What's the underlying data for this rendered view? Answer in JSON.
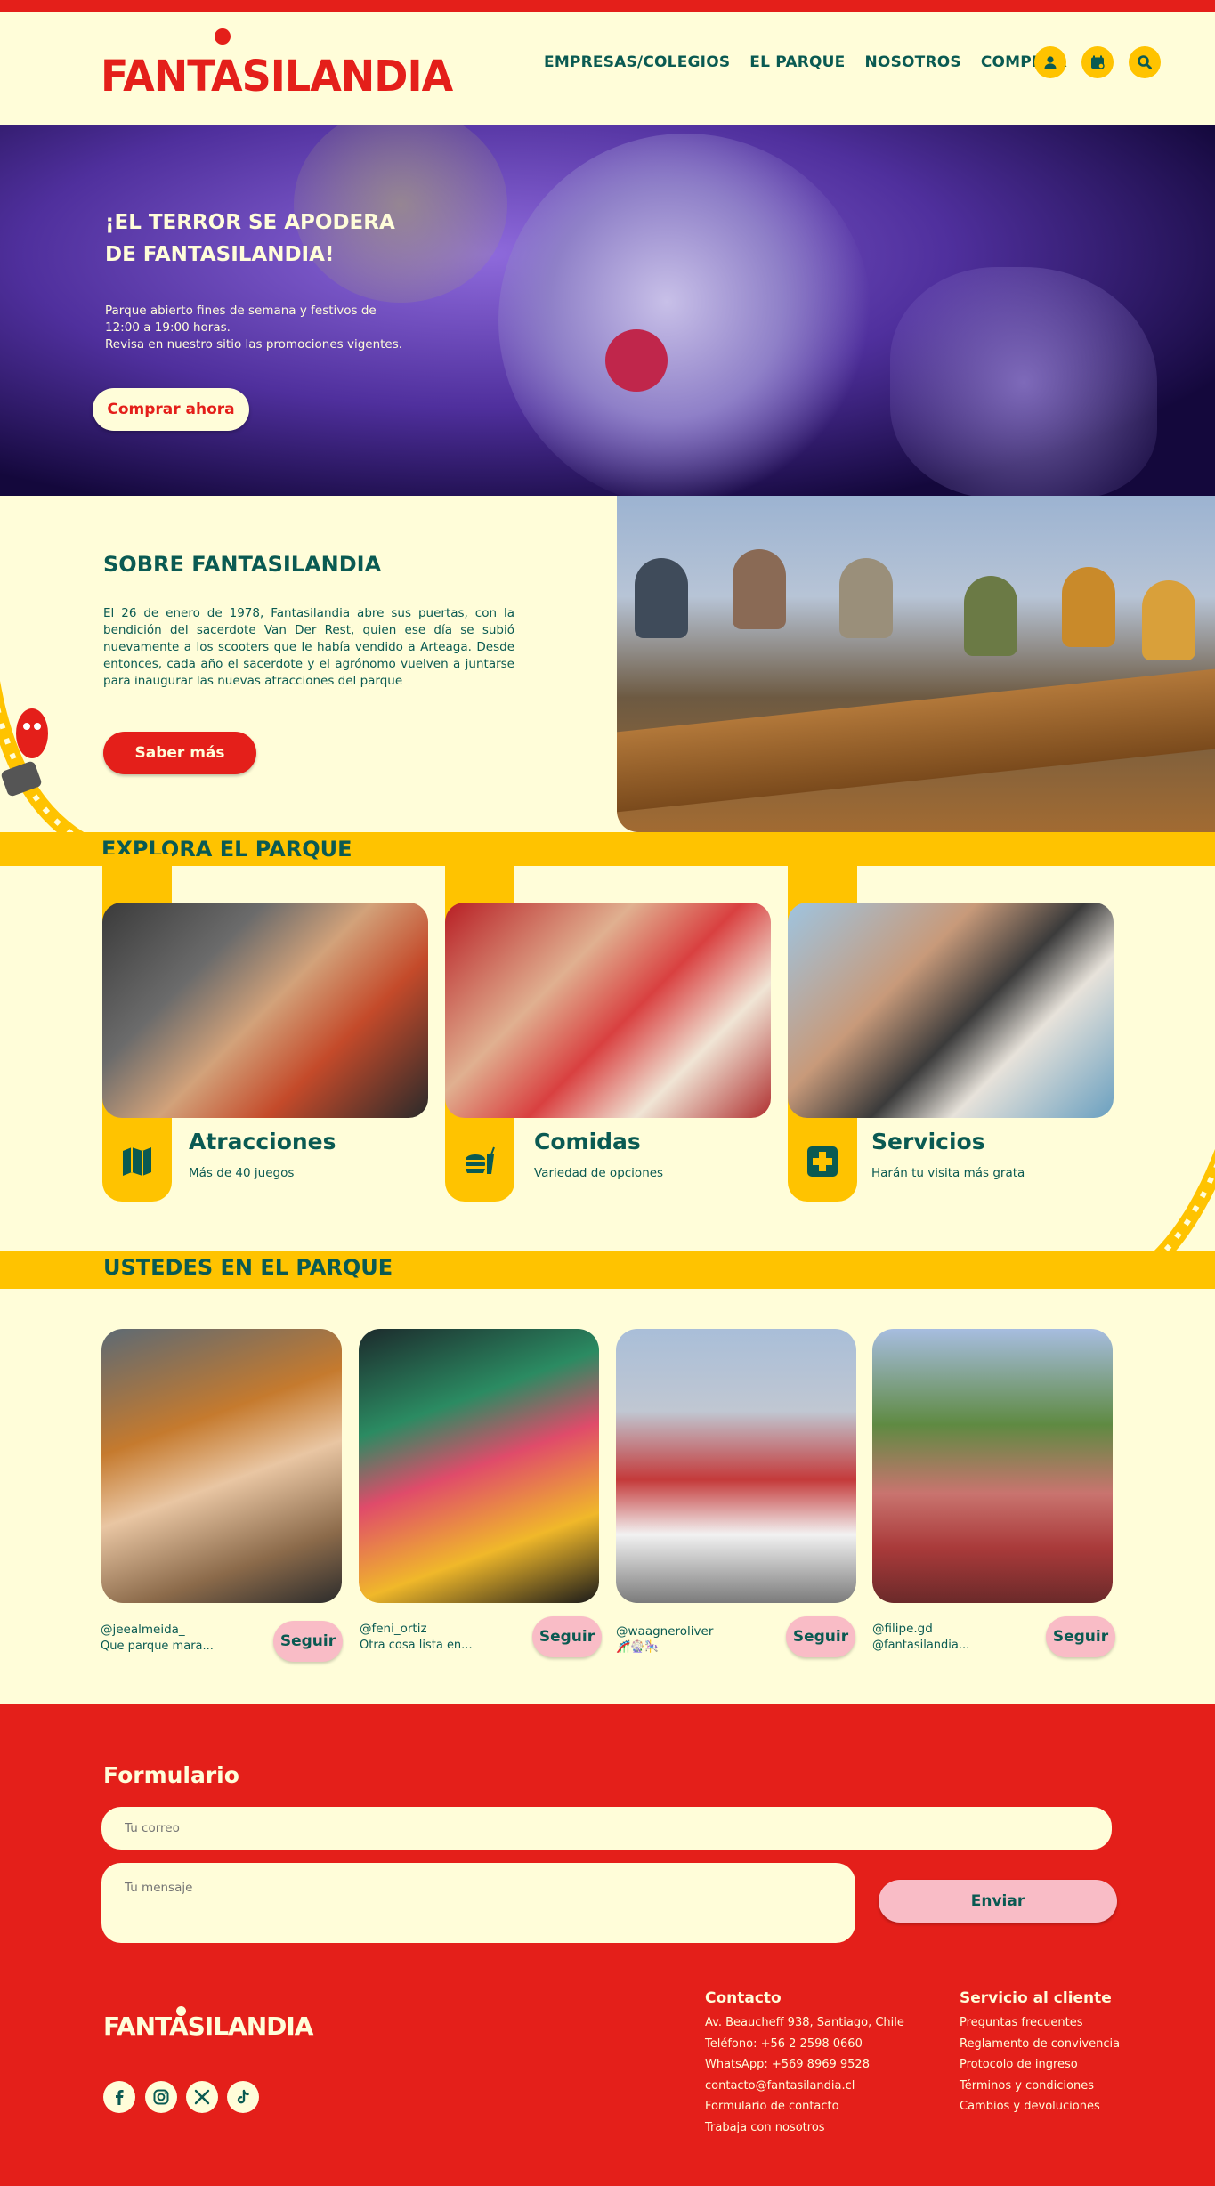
{
  "brand": {
    "logo_text": "FANTASILANDIA",
    "colors": {
      "red": "#e41f1a",
      "cream": "#fffdd9",
      "yellow": "#ffc300",
      "teal": "#0a5a52",
      "pink": "#f9bcc6"
    }
  },
  "nav": {
    "items": [
      "EMPRESAS/COLEGIOS",
      "EL PARQUE",
      "NOSOTROS",
      "COMPRAR"
    ],
    "icons": [
      "user-icon",
      "calendar-icon",
      "search-icon"
    ]
  },
  "hero": {
    "title": "¡EL TERROR SE APODERA DE FANTASILANDIA!",
    "text_line1": "Parque abierto fines de semana y festivos de 12:00 a 19:00 horas.",
    "text_line2": "Revisa en nuestro sitio las promociones vigentes.",
    "button": "Comprar ahora"
  },
  "about": {
    "title": "SOBRE FANTASILANDIA",
    "text": "El 26 de enero de 1978, Fantasilandia abre sus puertas, con la bendición del sacerdote Van Der Rest, quien ese día se subió nuevamente a los scooters que le había vendido a Arteaga. Desde entonces, cada año el sacerdote y el agrónomo vuelven a juntarse para inaugurar las nuevas atracciones del parque",
    "button": "Saber más"
  },
  "explore": {
    "title": "EXPLORA EL PARQUE",
    "cards": [
      {
        "title": "Atracciones",
        "subtitle": "Más de 40 juegos",
        "icon": "map-icon"
      },
      {
        "title": "Comidas",
        "subtitle": "Variedad de opciones",
        "icon": "food-icon"
      },
      {
        "title": "Servicios",
        "subtitle": "Harán tu visita más grata",
        "icon": "plus-icon"
      }
    ]
  },
  "ugc": {
    "title": "USTEDES EN EL PARQUE",
    "follow_label": "Seguir",
    "posts": [
      {
        "user": "@jeealmeida_",
        "caption": "Que parque mara..."
      },
      {
        "user": "@feni_ortiz",
        "caption": " Otra cosa lista en..."
      },
      {
        "user": "@waagneroliver",
        "caption": "🎢🎡🎠"
      },
      {
        "user": "@filipe.gd",
        "caption": "@fantasilandia..."
      }
    ]
  },
  "form": {
    "title": "Formulario",
    "email_placeholder": "Tu correo",
    "message_placeholder": "Tu mensaje",
    "submit": "Enviar"
  },
  "footer": {
    "logo_text": "FANTASILANDIA",
    "social": [
      "facebook-icon",
      "instagram-icon",
      "x-icon",
      "tiktok-icon"
    ],
    "contact": {
      "title": "Contacto",
      "items": [
        "Av. Beaucheff 938, Santiago, Chile",
        "Teléfono: +56 2 2598 0660",
        "WhatsApp: +569 8969 9528",
        "contacto@fantasilandia.cl",
        "Formulario de contacto",
        "Trabaja con nosotros"
      ]
    },
    "service": {
      "title": "Servicio al cliente",
      "items": [
        "Preguntas frecuentes",
        "Reglamento de convivencia",
        "Protocolo de ingreso",
        "Términos y condiciones",
        "Cambios y devoluciones"
      ]
    }
  }
}
